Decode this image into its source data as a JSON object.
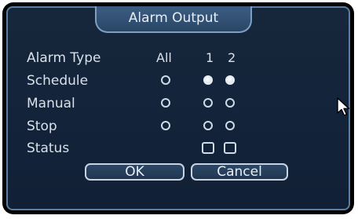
{
  "dialog": {
    "title": "Alarm Output"
  },
  "rows": {
    "alarm_type": "Alarm Type",
    "schedule": "Schedule",
    "manual": "Manual",
    "stop": "Stop",
    "status": "Status"
  },
  "columns": {
    "all": "All",
    "ch1": "1",
    "ch2": "2"
  },
  "state": {
    "schedule": {
      "all": false,
      "ch1": true,
      "ch2": true
    },
    "manual": {
      "all": false,
      "ch1": false,
      "ch2": false
    },
    "stop": {
      "all": false,
      "ch1": false,
      "ch2": false
    },
    "status": {
      "ch1": false,
      "ch2": false
    }
  },
  "buttons": {
    "ok": "OK",
    "cancel": "Cancel"
  },
  "colors": {
    "panel": "#13233a",
    "border": "#5b7ea2",
    "text": "#d8e0ea"
  }
}
